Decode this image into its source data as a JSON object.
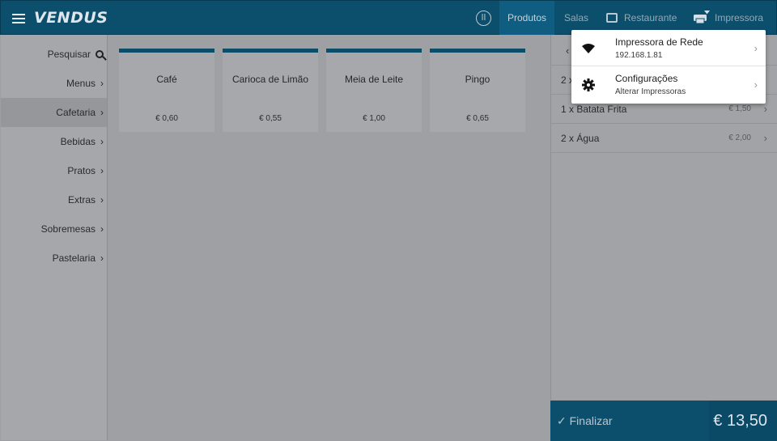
{
  "app": {
    "logo": "VENDUS"
  },
  "topbar": {
    "tabs": [
      {
        "label": "Produtos"
      },
      {
        "label": "Salas"
      },
      {
        "label": "Restaurante"
      },
      {
        "label": "Impressora"
      }
    ]
  },
  "sidebar": {
    "search_label": "Pesquisar",
    "items": [
      {
        "label": "Menus"
      },
      {
        "label": "Cafetaria"
      },
      {
        "label": "Bebidas"
      },
      {
        "label": "Pratos"
      },
      {
        "label": "Extras"
      },
      {
        "label": "Sobremesas"
      },
      {
        "label": "Pastelaria"
      }
    ],
    "active": "Cafetaria"
  },
  "products": [
    {
      "name": "Café",
      "price": "€ 0,60"
    },
    {
      "name": "Carioca de Limão",
      "price": "€ 0,55"
    },
    {
      "name": "Meia de Leite",
      "price": "€ 1,00"
    },
    {
      "name": "Pingo",
      "price": "€ 0,65"
    }
  ],
  "order": {
    "lines": [
      {
        "text": "2 x",
        "amount": ""
      },
      {
        "text": "1 x Batata Frita",
        "amount": "€ 1,50"
      },
      {
        "text": "2 x Água",
        "amount": "€ 2,00"
      }
    ],
    "finalize_label": "Finalizar",
    "total": "€ 13,50"
  },
  "printer_menu": {
    "items": [
      {
        "title": "Impressora de Rede",
        "subtitle": "192.168.1.81"
      },
      {
        "title": "Configurações",
        "subtitle": "Alterar Impressoras"
      }
    ]
  },
  "colors": {
    "brand": "#0c4f6d",
    "card_accent": "#0d4d6a",
    "overlay_gray": "#9e9fa2"
  }
}
